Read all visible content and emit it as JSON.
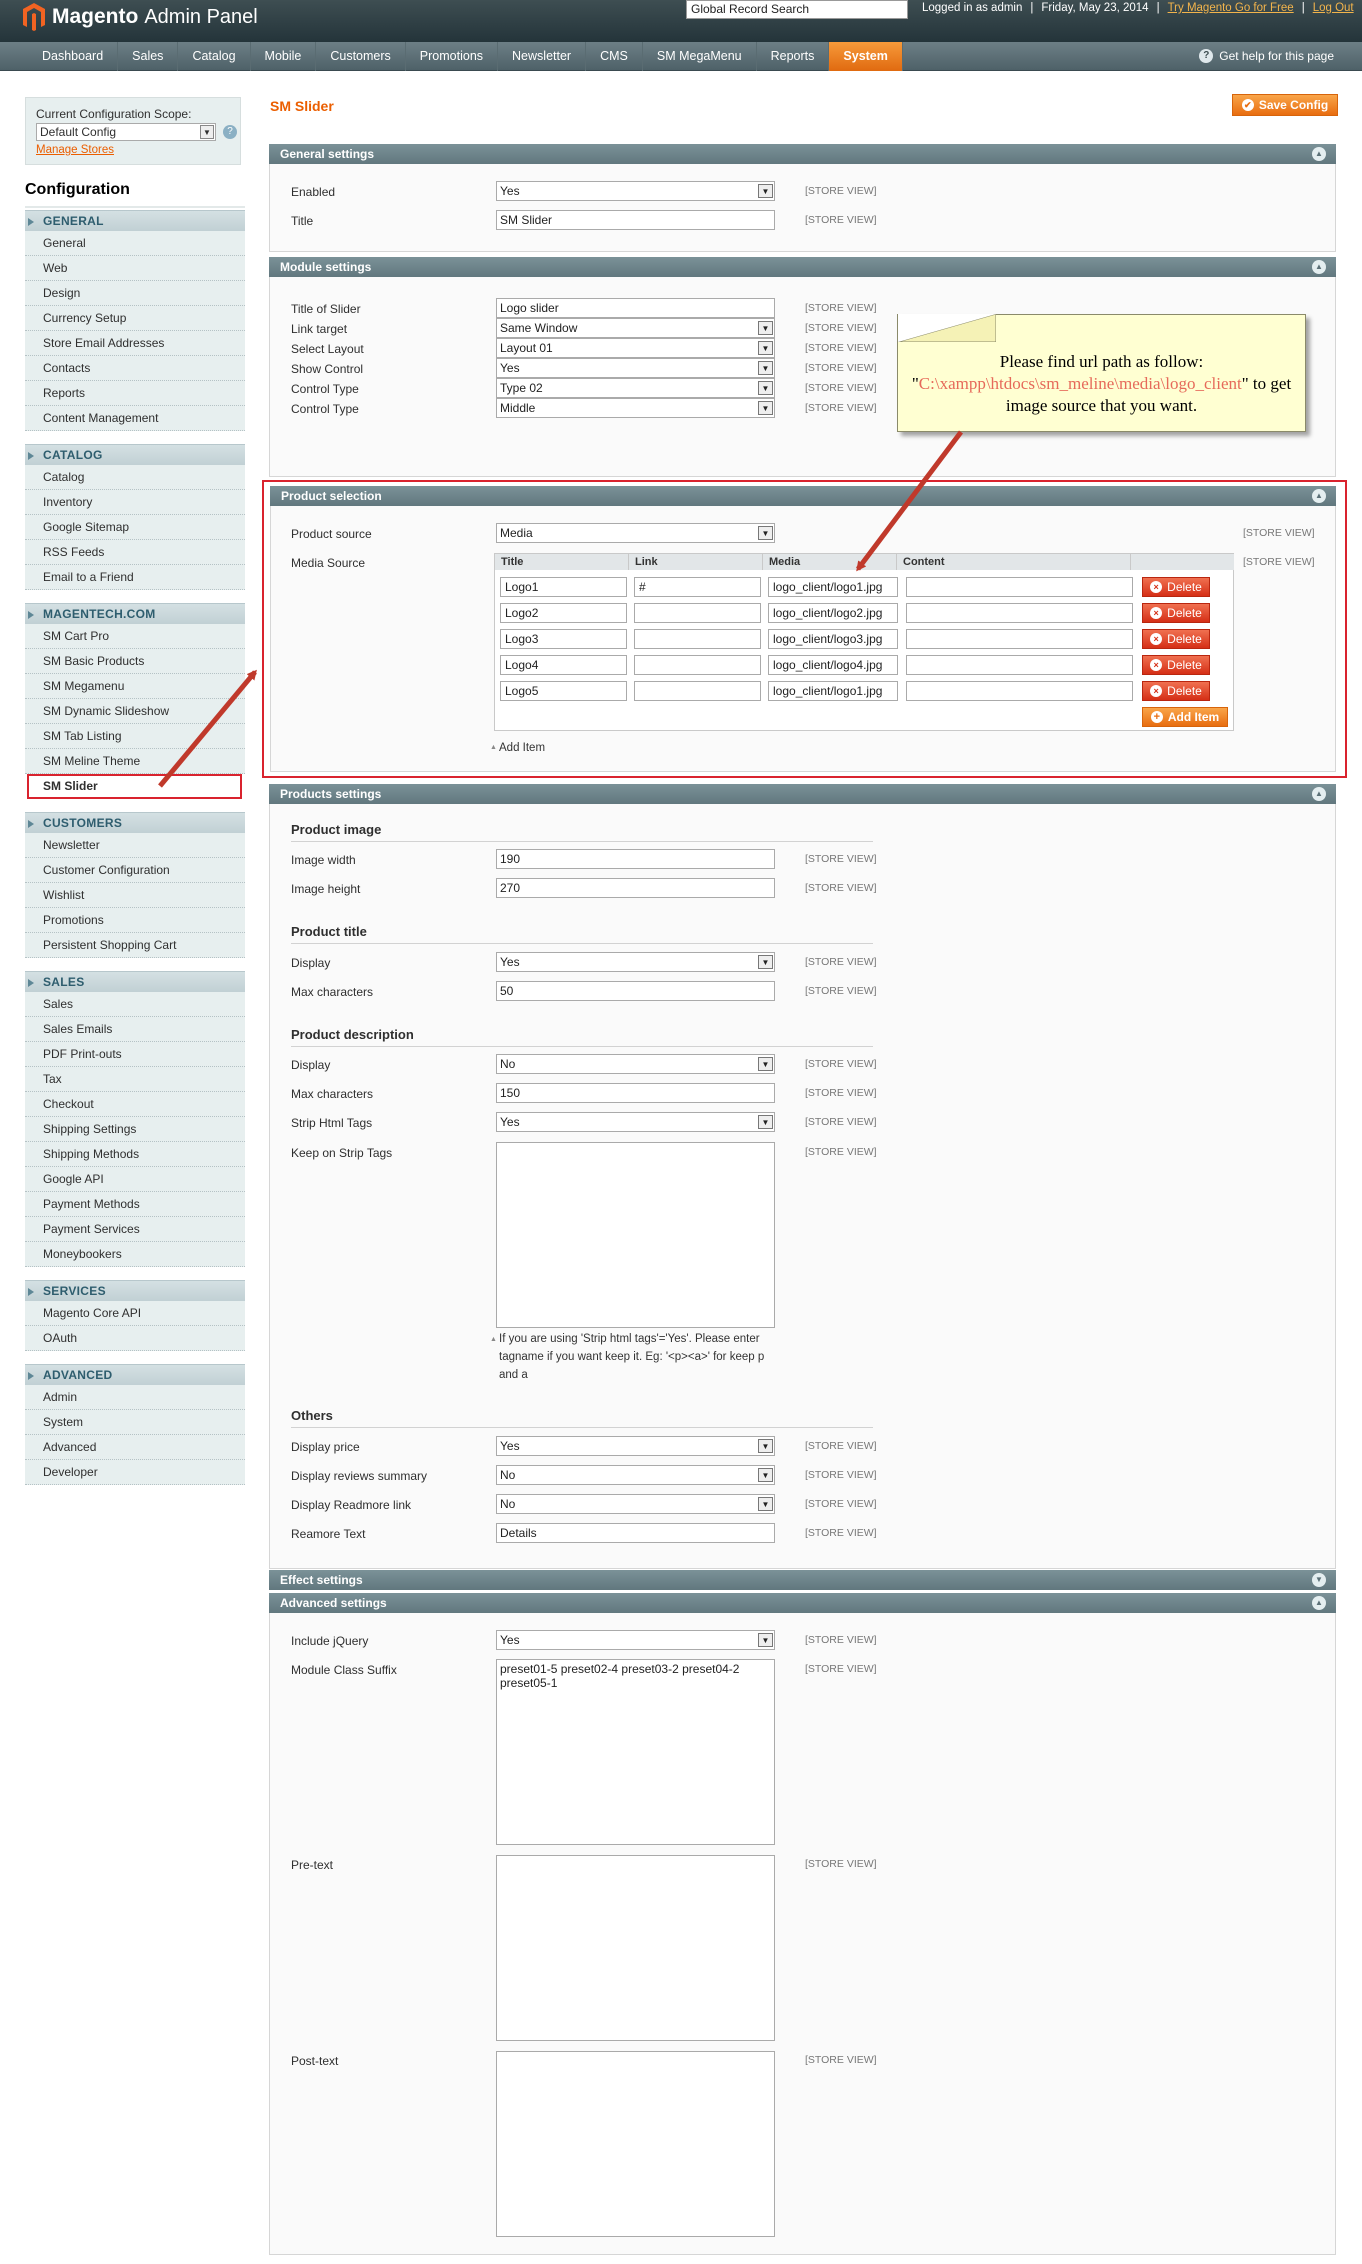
{
  "header": {
    "brand": "Magento",
    "brand_suffix": "Admin Panel",
    "search_value": "Global Record Search",
    "logged_in": "Logged in as admin",
    "date": "Friday, May 23, 2014",
    "try_link": "Try Magento Go for Free",
    "logout": "Log Out",
    "help": "Get help for this page"
  },
  "nav": [
    "Dashboard",
    "Sales",
    "Catalog",
    "Mobile",
    "Customers",
    "Promotions",
    "Newsletter",
    "CMS",
    "SM MegaMenu",
    "Reports",
    "System"
  ],
  "nav_active": "System",
  "scope": {
    "label": "Current Configuration Scope:",
    "value": "Default Config",
    "manage": "Manage Stores"
  },
  "config_title": "Configuration",
  "sidebar": [
    {
      "title": "GENERAL",
      "items": [
        "General",
        "Web",
        "Design",
        "Currency Setup",
        "Store Email Addresses",
        "Contacts",
        "Reports",
        "Content Management"
      ]
    },
    {
      "title": "CATALOG",
      "items": [
        "Catalog",
        "Inventory",
        "Google Sitemap",
        "RSS Feeds",
        "Email to a Friend"
      ]
    },
    {
      "title": "MAGENTECH.COM",
      "items": [
        "SM Cart Pro",
        "SM Basic Products",
        "SM Megamenu",
        "SM Dynamic Slideshow",
        "SM Tab Listing",
        "SM Meline Theme",
        "SM Slider"
      ]
    },
    {
      "title": "CUSTOMERS",
      "items": [
        "Newsletter",
        "Customer Configuration",
        "Wishlist",
        "Promotions",
        "Persistent Shopping Cart"
      ]
    },
    {
      "title": "SALES",
      "items": [
        "Sales",
        "Sales Emails",
        "PDF Print-outs",
        "Tax",
        "Checkout",
        "Shipping Settings",
        "Shipping Methods",
        "Google API",
        "Payment Methods",
        "Payment Services",
        "Moneybookers"
      ]
    },
    {
      "title": "SERVICES",
      "items": [
        "Magento Core API",
        "OAuth"
      ]
    },
    {
      "title": "ADVANCED",
      "items": [
        "Admin",
        "System",
        "Advanced",
        "Developer"
      ]
    }
  ],
  "sidebar_current": "SM Slider",
  "page": {
    "title": "SM Slider",
    "save": "Save Config",
    "store_view": "[STORE VIEW]"
  },
  "general": {
    "header": "General settings",
    "enabled_label": "Enabled",
    "enabled": "Yes",
    "title_label": "Title",
    "title": "SM Slider"
  },
  "module": {
    "header": "Module settings",
    "rows": [
      {
        "label": "Title of Slider",
        "value": "Logo slider",
        "select": false
      },
      {
        "label": "Link target",
        "value": "Same Window",
        "select": true
      },
      {
        "label": "Select Layout",
        "value": "Layout 01",
        "select": true
      },
      {
        "label": "Show Control",
        "value": "Yes",
        "select": true
      },
      {
        "label": "Control Type",
        "value": "Type 02",
        "select": true
      },
      {
        "label": "Control Type",
        "value": "Middle",
        "select": true
      }
    ]
  },
  "callout": {
    "text1": "Please find url path as follow:  \"",
    "path": "C:\\xampp\\htdocs\\sm_meline\\media\\logo_client",
    "text2": "\" to get image source that you want."
  },
  "product_selection": {
    "header": "Product selection",
    "source_label": "Product source",
    "source": "Media",
    "media_label": "Media Source",
    "columns": [
      "Title",
      "Link",
      "Media",
      "Content"
    ],
    "rows": [
      {
        "title": "Logo1",
        "link": "#",
        "media": "logo_client/logo1.jpg",
        "content": ""
      },
      {
        "title": "Logo2",
        "link": "",
        "media": "logo_client/logo2.jpg",
        "content": ""
      },
      {
        "title": "Logo3",
        "link": "",
        "media": "logo_client/logo3.jpg",
        "content": ""
      },
      {
        "title": "Logo4",
        "link": "",
        "media": "logo_client/logo4.jpg",
        "content": ""
      },
      {
        "title": "Logo5",
        "link": "",
        "media": "logo_client/logo1.jpg",
        "content": ""
      }
    ],
    "delete": "Delete",
    "add_item_btn": "Add Item",
    "add_item_link": "Add Item"
  },
  "products": {
    "header": "Products settings",
    "image_h": "Product image",
    "width_label": "Image width",
    "width": "190",
    "height_label": "Image height",
    "height": "270",
    "title_h": "Product title",
    "display_label": "Display",
    "title_display": "Yes",
    "maxchar_label": "Max characters",
    "title_max": "50",
    "desc_h": "Product description",
    "desc_display": "No",
    "desc_max": "150",
    "strip_label": "Strip Html Tags",
    "strip": "Yes",
    "keep_label": "Keep on Strip Tags",
    "note": "If you are using 'Strip html tags'='Yes'. Please enter tagname if you want keep it. Eg: '<p><a>' for keep p and a",
    "others_h": "Others",
    "price_label": "Display price",
    "price": "Yes",
    "reviews_label": "Display reviews summary",
    "reviews": "No",
    "readmore_label": "Display Readmore link",
    "readmore": "No",
    "readtext_label": "Reamore Text",
    "readtext": "Details"
  },
  "effect": {
    "header": "Effect settings"
  },
  "advanced": {
    "header": "Advanced settings",
    "jquery_label": "Include jQuery",
    "jquery": "Yes",
    "suffix_label": "Module Class Suffix",
    "suffix": "preset01-5 preset02-4 preset03-2 preset04-2 preset05-1",
    "pre_label": "Pre-text",
    "post_label": "Post-text"
  }
}
